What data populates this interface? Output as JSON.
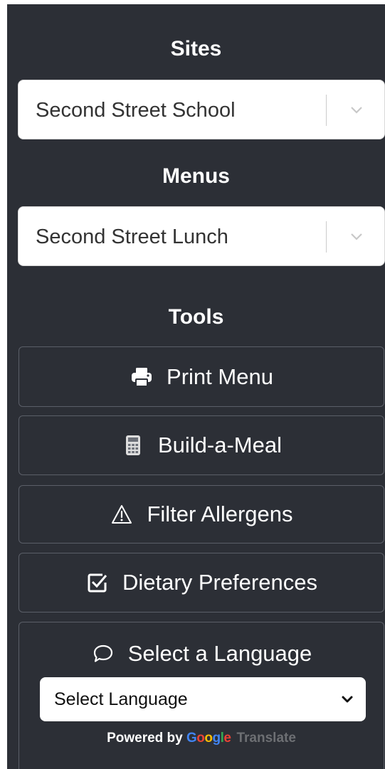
{
  "sites": {
    "heading": "Sites",
    "selected": "Second Street School"
  },
  "menus": {
    "heading": "Menus",
    "selected": "Second Street Lunch"
  },
  "tools": {
    "heading": "Tools",
    "print": {
      "label": "Print Menu",
      "icon": "printer-icon"
    },
    "build": {
      "label": "Build-a-Meal",
      "icon": "calculator-icon"
    },
    "allergens": {
      "label": "Filter Allergens",
      "icon": "warning-icon"
    },
    "dietary": {
      "label": "Dietary Preferences",
      "icon": "checkbox-icon"
    },
    "language": {
      "label": "Select a Language",
      "icon": "speech-bubble-icon",
      "select_value": "Select Language",
      "powered_by": "Powered by",
      "brand_letters": [
        "G",
        "o",
        "o",
        "g",
        "l",
        "e"
      ],
      "translate": "Translate"
    }
  },
  "colors": {
    "panel_bg": "#2c2f36",
    "button_border": "#5b5f68",
    "text": "#ffffff"
  }
}
